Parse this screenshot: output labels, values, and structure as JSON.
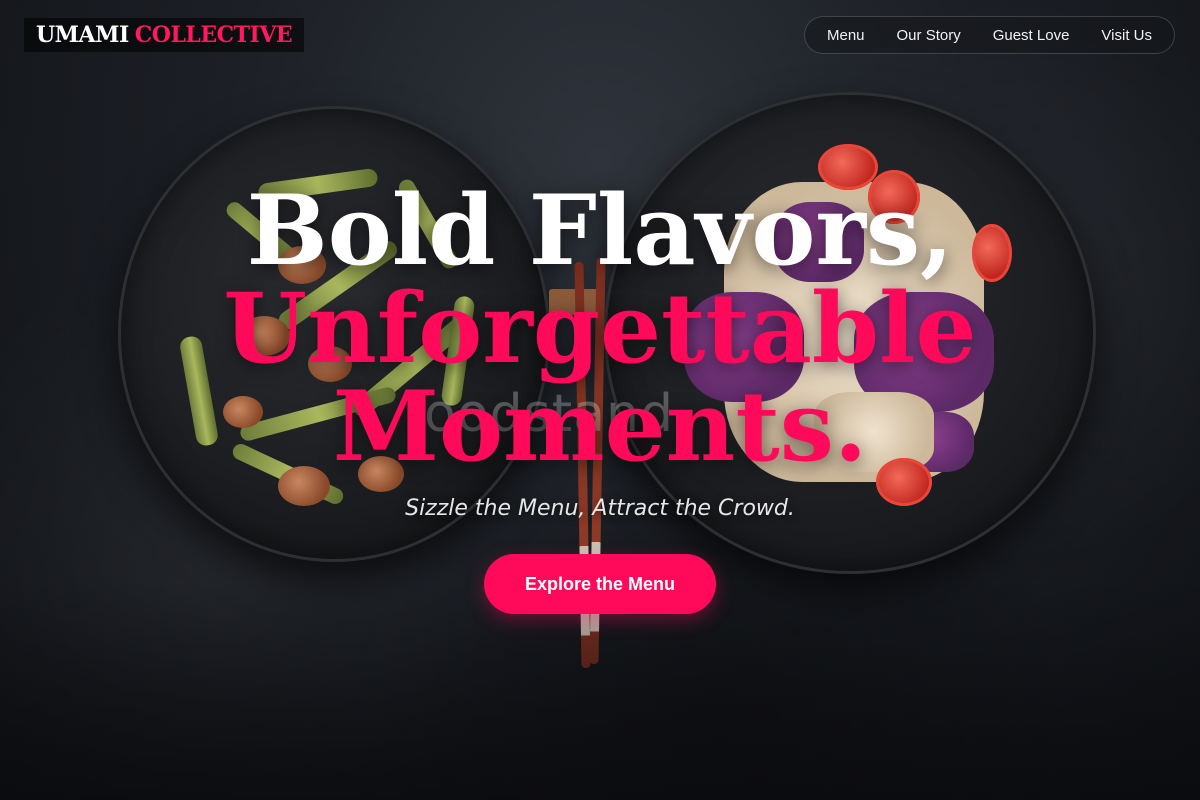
{
  "brand": {
    "word1": "UMAMI",
    "word2": "COLLECTIVE",
    "accent_color": "#ff0a5a"
  },
  "nav": {
    "items": [
      {
        "label": "Menu"
      },
      {
        "label": "Our Story"
      },
      {
        "label": "Guest Love"
      },
      {
        "label": "Visit Us"
      }
    ]
  },
  "hero": {
    "line1": "Bold Flavors,",
    "line2": "Unforgettable",
    "line3": "Moments.",
    "tagline": "Sizzle the Menu, Attract the Crowd.",
    "cta_label": "Explore the Menu"
  },
  "watermark": "oodstand",
  "background_image": {
    "subject": "two black bowls with shrimp stir-fry and cabbage slaw, chopsticks between"
  }
}
